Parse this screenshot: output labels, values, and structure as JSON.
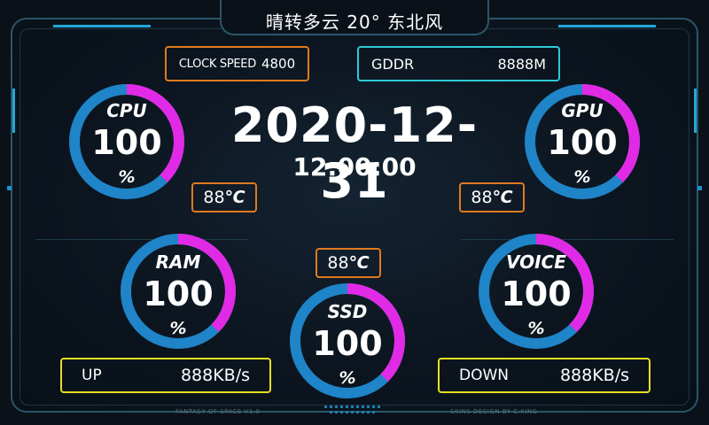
{
  "weather": {
    "text": "晴转多云 20° 东北风"
  },
  "clock_speed": {
    "label": "CLOCK SPEED",
    "value": "4800"
  },
  "gddr": {
    "label": "GDDR",
    "value": "8888M"
  },
  "datetime": {
    "date": "2020-12-31",
    "time": "12:00:00"
  },
  "gauges": {
    "cpu": {
      "label": "CPU",
      "value": "100",
      "unit": "%"
    },
    "gpu": {
      "label": "GPU",
      "value": "100",
      "unit": "%"
    },
    "ram": {
      "label": "RAM",
      "value": "100",
      "unit": "%"
    },
    "ssd": {
      "label": "SSD",
      "value": "100",
      "unit": "%"
    },
    "voice": {
      "label": "VOICE",
      "value": "100",
      "unit": "%"
    }
  },
  "temps": {
    "cpu": {
      "value": "88",
      "unit": "℃"
    },
    "gpu": {
      "value": "88",
      "unit": "℃"
    },
    "ssd": {
      "value": "88",
      "unit": "℃"
    }
  },
  "network": {
    "up": {
      "label": "UP",
      "value": "888KB/s"
    },
    "down": {
      "label": "DOWN",
      "value": "888KB/s"
    }
  },
  "footer": {
    "left": "FANTASY OF SPACE V1.0",
    "right": "SKINS DESIGN BY C.KING"
  },
  "colors": {
    "ring_blue": "#1f84c8",
    "ring_magenta": "#e12ae6",
    "orange": "#e07a1f",
    "cyan": "#2ec9d6",
    "yellow": "#e6df1f"
  }
}
